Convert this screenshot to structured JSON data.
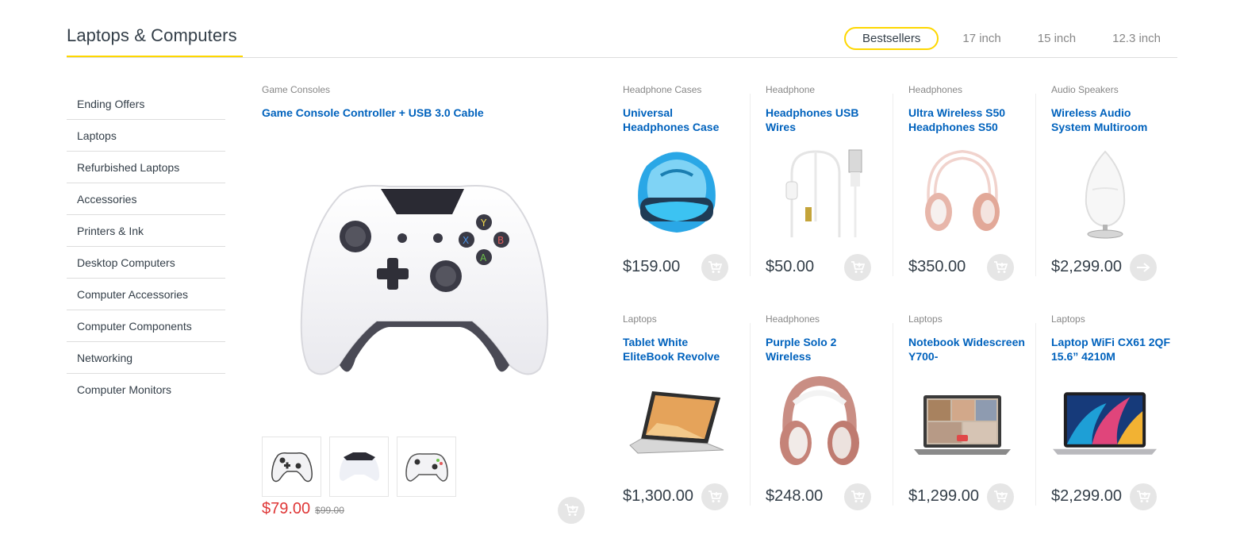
{
  "header": {
    "title": "Laptops & Computers",
    "tabs": [
      {
        "label": "Bestsellers",
        "active": true
      },
      {
        "label": "17 inch",
        "active": false
      },
      {
        "label": "15 inch",
        "active": false
      },
      {
        "label": "12.3 inch",
        "active": false
      }
    ]
  },
  "sidebar": {
    "items": [
      {
        "label": "Ending Offers"
      },
      {
        "label": "Laptops"
      },
      {
        "label": "Refurbished Laptops"
      },
      {
        "label": "Accessories"
      },
      {
        "label": "Printers & Ink"
      },
      {
        "label": "Desktop Computers"
      },
      {
        "label": "Computer Accessories"
      },
      {
        "label": "Computer Components"
      },
      {
        "label": "Networking"
      },
      {
        "label": "Computer Monitors"
      }
    ]
  },
  "featured": {
    "category": "Game Consoles",
    "title": "Game Console Controller + USB 3.0 Cable",
    "price": "$79.00",
    "old_price": "$99.00",
    "image_icon": "game-controller-icon",
    "thumbnails": [
      "controller-front-thumb",
      "controller-back-thumb",
      "controller-angle-thumb"
    ],
    "cart_icon": "add-to-cart-icon"
  },
  "products": [
    {
      "category": "Headphone Cases",
      "title": "Universal Headphones Case",
      "price": "$159.00",
      "icon": "headphone-case-icon",
      "action_icon": "add-to-cart-icon"
    },
    {
      "category": "Headphone",
      "title": "Headphones USB Wires",
      "price": "$50.00",
      "icon": "usb-cable-icon",
      "action_icon": "add-to-cart-icon"
    },
    {
      "category": "Headphones",
      "title": "Ultra Wireless S50 Headphones S50",
      "price": "$350.00",
      "icon": "headphones-icon",
      "action_icon": "add-to-cart-icon"
    },
    {
      "category": "Audio Speakers",
      "title": "Wireless Audio System Multiroom",
      "price": "$2,299.00",
      "icon": "speaker-icon",
      "action_icon": "arrow-right-icon"
    },
    {
      "category": "Laptops",
      "title": "Tablet White EliteBook Revolve",
      "price": "$1,300.00",
      "icon": "convertible-laptop-icon",
      "action_icon": "add-to-cart-icon"
    },
    {
      "category": "Headphones",
      "title": "Purple Solo 2 Wireless",
      "price": "$248.00",
      "icon": "headphones-icon",
      "action_icon": "add-to-cart-icon"
    },
    {
      "category": "Laptops",
      "title": "Notebook Widescreen Y700-",
      "price": "$1,299.00",
      "icon": "notebook-icon",
      "action_icon": "add-to-cart-icon"
    },
    {
      "category": "Laptops",
      "title": "Laptop WiFi CX61 2QF 15.6” 4210M",
      "price": "$2,299.00",
      "icon": "laptop-icon",
      "action_icon": "add-to-cart-icon"
    }
  ],
  "colors": {
    "accent": "#fed700",
    "link": "#0062bd",
    "sale": "#df3737",
    "text": "#333e48",
    "muted": "#878787"
  }
}
